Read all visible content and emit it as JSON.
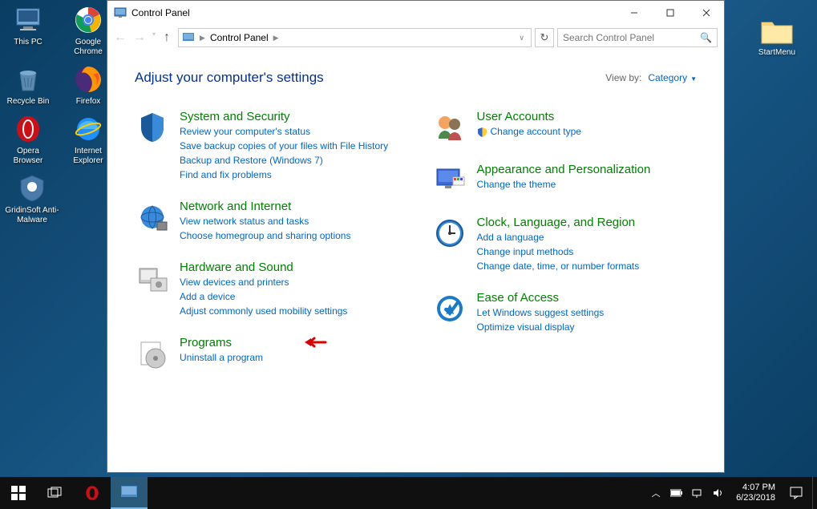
{
  "desktop": {
    "icons_left": [
      {
        "label": "This PC",
        "icon": "pc"
      },
      {
        "label": "Google Chrome",
        "icon": "chrome"
      },
      {
        "label": "Recycle Bin",
        "icon": "recycle"
      },
      {
        "label": "Firefox",
        "icon": "firefox"
      },
      {
        "label": "Opera Browser",
        "icon": "opera"
      },
      {
        "label": "Internet Explorer",
        "icon": "ie"
      },
      {
        "label": "GridinSoft Anti-Malware",
        "icon": "gridinsoft"
      }
    ],
    "icon_right": {
      "label": "StartMenu",
      "icon": "folder"
    }
  },
  "window": {
    "title": "Control Panel",
    "breadcrumb": "Control Panel",
    "search_placeholder": "Search Control Panel",
    "heading": "Adjust your computer's settings",
    "viewby_label": "View by:",
    "viewby_value": "Category"
  },
  "categories_left": [
    {
      "title": "System and Security",
      "icon": "system-security",
      "links": [
        {
          "text": "Review your computer's status"
        },
        {
          "text": "Save backup copies of your files with File History"
        },
        {
          "text": "Backup and Restore (Windows 7)"
        },
        {
          "text": "Find and fix problems"
        }
      ]
    },
    {
      "title": "Network and Internet",
      "icon": "network",
      "links": [
        {
          "text": "View network status and tasks"
        },
        {
          "text": "Choose homegroup and sharing options"
        }
      ]
    },
    {
      "title": "Hardware and Sound",
      "icon": "hardware",
      "links": [
        {
          "text": "View devices and printers"
        },
        {
          "text": "Add a device"
        },
        {
          "text": "Adjust commonly used mobility settings"
        }
      ]
    },
    {
      "title": "Programs",
      "icon": "programs",
      "links": [
        {
          "text": "Uninstall a program"
        }
      ]
    }
  ],
  "categories_right": [
    {
      "title": "User Accounts",
      "icon": "users",
      "links": [
        {
          "text": "Change account type",
          "shield": true
        }
      ]
    },
    {
      "title": "Appearance and Personalization",
      "icon": "appearance",
      "links": [
        {
          "text": "Change the theme"
        }
      ]
    },
    {
      "title": "Clock, Language, and Region",
      "icon": "clock",
      "links": [
        {
          "text": "Add a language"
        },
        {
          "text": "Change input methods"
        },
        {
          "text": "Change date, time, or number formats"
        }
      ]
    },
    {
      "title": "Ease of Access",
      "icon": "ease",
      "links": [
        {
          "text": "Let Windows suggest settings"
        },
        {
          "text": "Optimize visual display"
        }
      ]
    }
  ],
  "taskbar": {
    "time": "4:07 PM",
    "date": "6/23/2018"
  }
}
